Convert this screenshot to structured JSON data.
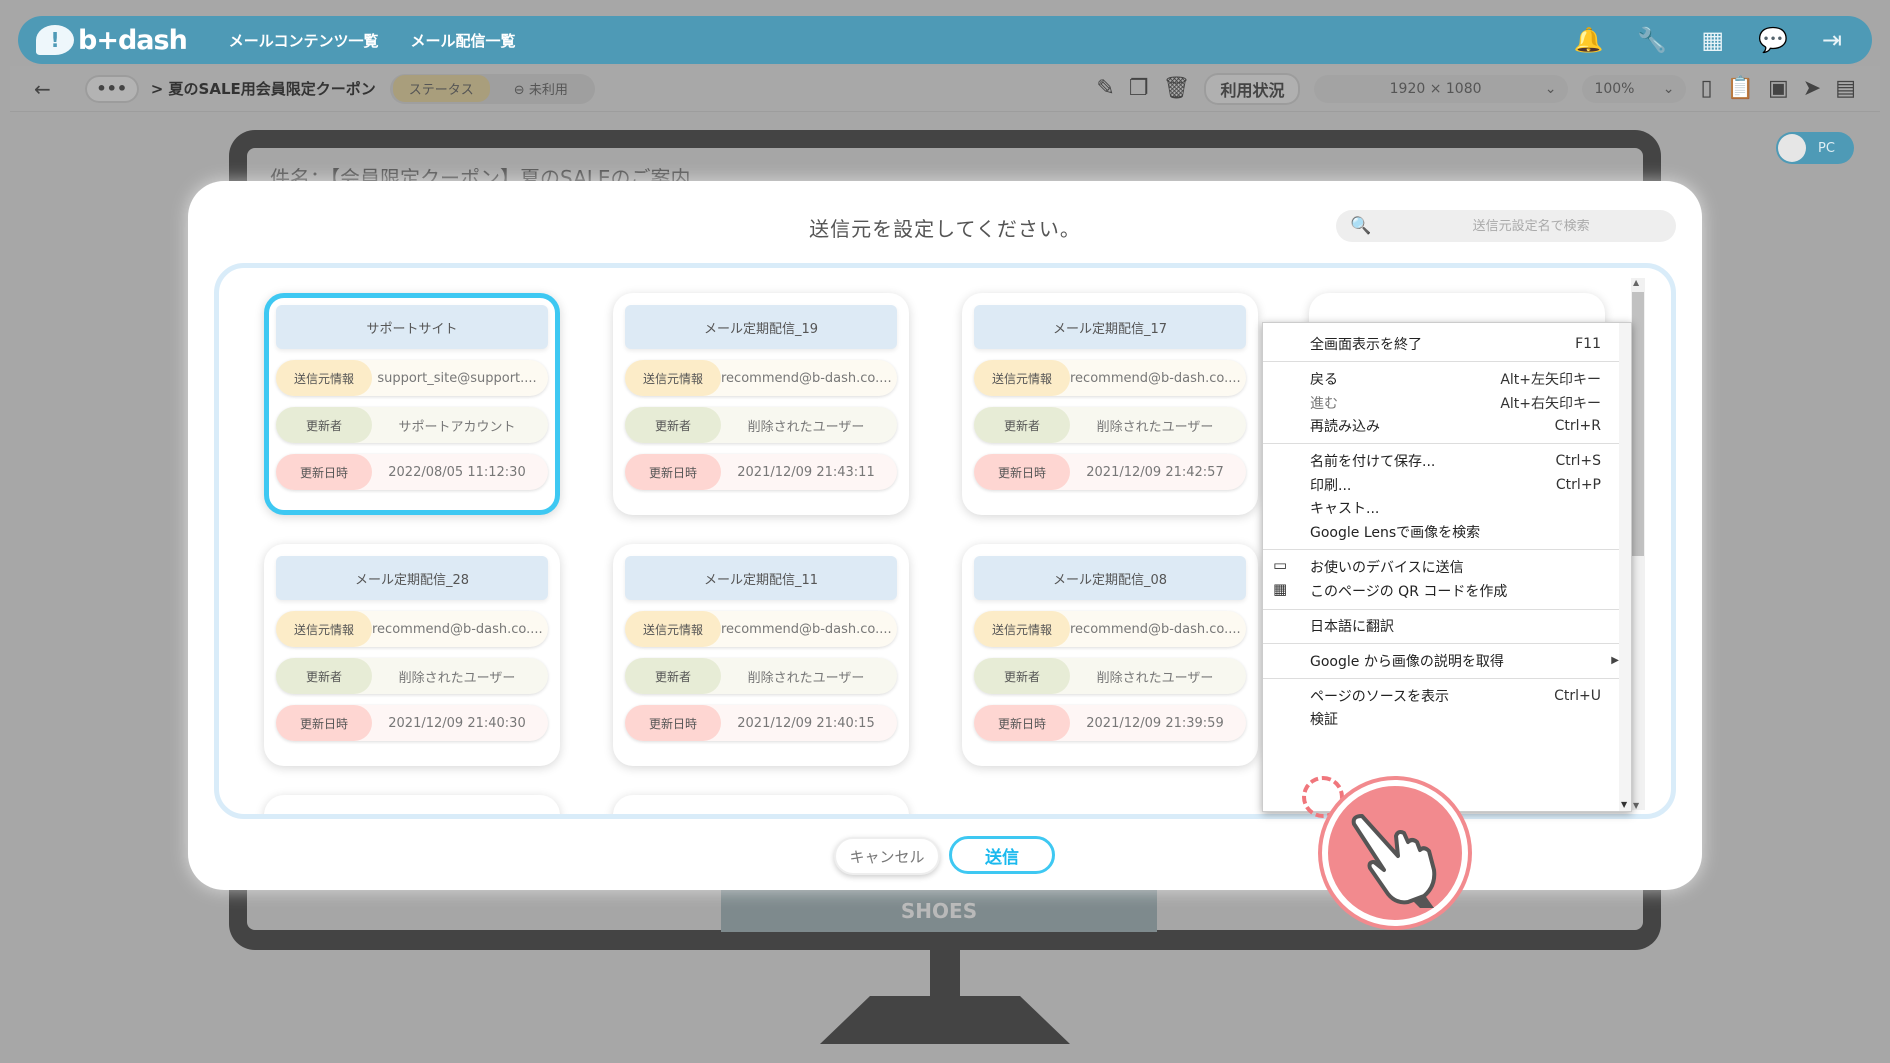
{
  "app": {
    "logo_text": "b+dash",
    "nav": [
      "メールコンテンツ一覧",
      "メール配信一覧"
    ]
  },
  "toolbar": {
    "back_label": "←",
    "more_label": "•••",
    "breadcrumb": "> 夏のSALE用会員限定クーポン",
    "status_label": "ステータス",
    "status_value": "未利用",
    "usage_label": "利用状況",
    "resolution": "1920 × 1080",
    "zoom": "100%",
    "view_toggle": "PC"
  },
  "preview": {
    "subject": "件名：【会員限定クーポン】夏のSALEのご案内",
    "banner_text": "SHOES"
  },
  "modal": {
    "title": "送信元を設定してください。",
    "search_placeholder": "送信元設定名で検索",
    "cancel_label": "キャンセル",
    "send_label": "送信",
    "row_labels": {
      "sender": "送信元情報",
      "updater": "更新者",
      "updated_at": "更新日時"
    },
    "cards": [
      {
        "name": "サポートサイト",
        "sender": "support_site@support....",
        "updater": "サポートアカウント",
        "updated_at": "2022/08/05 11:12:30",
        "selected": true
      },
      {
        "name": "メール定期配信_19",
        "sender": "recommend@b-dash.co....",
        "updater": "削除されたユーザー",
        "updated_at": "2021/12/09 21:43:11",
        "selected": false
      },
      {
        "name": "メール定期配信_17",
        "sender": "recommend@b-dash.co....",
        "updater": "削除されたユーザー",
        "updated_at": "2021/12/09 21:42:57",
        "selected": false
      },
      {
        "name": "メール定期配信_28",
        "sender": "recommend@b-dash.co....",
        "updater": "削除されたユーザー",
        "updated_at": "2021/12/09 21:40:30",
        "selected": false
      },
      {
        "name": "メール定期配信_11",
        "sender": "recommend@b-dash.co....",
        "updater": "削除されたユーザー",
        "updated_at": "2021/12/09 21:40:15",
        "selected": false
      },
      {
        "name": "メール定期配信_08",
        "sender": "recommend@b-dash.co....",
        "updater": "削除されたユーザー",
        "updated_at": "2021/12/09 21:39:59",
        "selected": false
      }
    ]
  },
  "context_menu": {
    "items": [
      {
        "label": "全画面表示を終了",
        "shortcut": "F11"
      },
      {
        "label": "戻る",
        "shortcut": "Alt+左矢印キー"
      },
      {
        "label": "進む",
        "shortcut": "Alt+右矢印キー"
      },
      {
        "label": "再読み込み",
        "shortcut": "Ctrl+R"
      },
      {
        "label": "名前を付けて保存...",
        "shortcut": "Ctrl+S"
      },
      {
        "label": "印刷...",
        "shortcut": "Ctrl+P"
      },
      {
        "label": "キャスト...",
        "shortcut": ""
      },
      {
        "label": "Google Lensで画像を検索",
        "shortcut": ""
      },
      {
        "label": "お使いのデバイスに送信",
        "shortcut": ""
      },
      {
        "label": "このページの QR コードを作成",
        "shortcut": ""
      },
      {
        "label": "日本語に翻訳",
        "shortcut": ""
      },
      {
        "label": "Google から画像の説明を取得",
        "shortcut": ""
      },
      {
        "label": "ページのソースを表示",
        "shortcut": "Ctrl+U"
      },
      {
        "label": "検証",
        "shortcut": ""
      }
    ]
  },
  "colors": {
    "brand": "#4e9ab6",
    "selected_border": "#3ec8f2",
    "pointer": "#f28a8e"
  }
}
